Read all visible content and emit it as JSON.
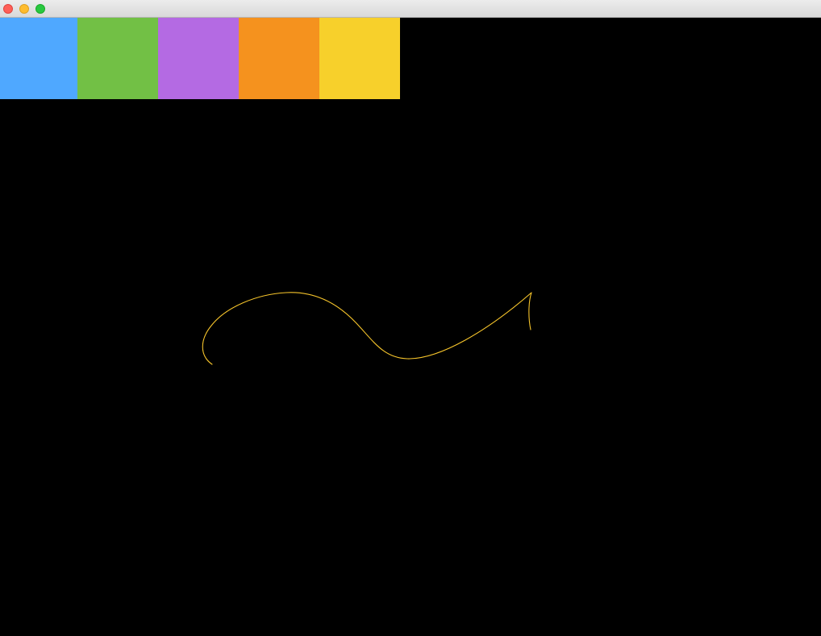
{
  "window": {
    "title": "",
    "controls": [
      {
        "name": "close",
        "color": "#fe5f57",
        "border": "#e0443e"
      },
      {
        "name": "minimize",
        "color": "#febc2e",
        "border": "#dea123"
      },
      {
        "name": "zoom",
        "color": "#28c840",
        "border": "#1aab29"
      }
    ]
  },
  "palette": {
    "colors": [
      {
        "name": "blue",
        "hex": "#4fa8ff"
      },
      {
        "name": "green",
        "hex": "#72c045"
      },
      {
        "name": "purple",
        "hex": "#b46ae3"
      },
      {
        "name": "orange",
        "hex": "#f5921e"
      },
      {
        "name": "yellow",
        "hex": "#f7d02b"
      }
    ]
  },
  "canvas": {
    "background": "#000000",
    "stroke_color": "#f7c52b"
  }
}
